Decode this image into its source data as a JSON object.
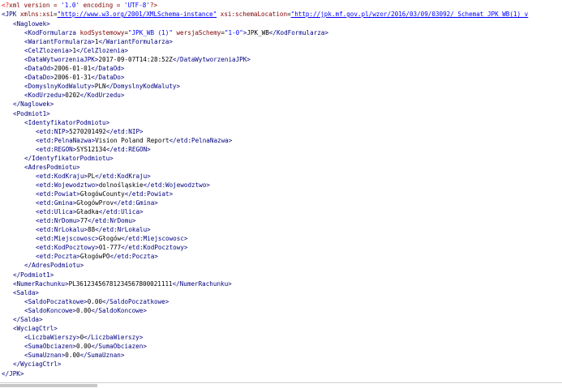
{
  "decl": {
    "a": "<?",
    "b": "xml version = ",
    "c": "'1.0'",
    "d": " encoding = ",
    "e": "'UTF-8'",
    "f": "?>"
  },
  "root": {
    "open_a": "<JPK ",
    "attr1": "xmlns:xsi",
    "eq1": "=",
    "v1": "\"http://www.w3.org/2001/XMLSchema-instance\"",
    "attr2": " xsi:schemaLocation",
    "eq2": "=",
    "v2": "\"http://jpk.mf.gov.pl/wzor/2016/03/09/03092/ Schemat_JPK_WB(1)_v",
    "close": "</JPK>"
  },
  "naglowek": {
    "open": "<Naglowek>",
    "kod": {
      "open": "<KodFormularza ",
      "a1": "kodSystemowy",
      "v1": "\"JPK_WB (1)\"",
      "a2": " wersjaSchemy",
      "v2": "\"1-0\"",
      "gt": ">",
      "text": "JPK_WB",
      "close": "</KodFormularza>"
    },
    "wariant": {
      "open": "<WariantFormularza>",
      "text": "1",
      "close": "</WariantFormularza>"
    },
    "cel": {
      "open": "<CelZlozenia>",
      "text": "1",
      "close": "</CelZlozenia>"
    },
    "data_wyt": {
      "open": "<DataWytworzeniaJPK>",
      "text": "2017-09-07T14:28:52Z",
      "close": "</DataWytworzeniaJPK>"
    },
    "data_od": {
      "open": "<DataOd>",
      "text": "2006-01-01",
      "close": "</DataOd>"
    },
    "data_do": {
      "open": "<DataDo>",
      "text": "2006-01-31",
      "close": "</DataDo>"
    },
    "waluta": {
      "open": "<DomyslnyKodWaluty>",
      "text": "PLN",
      "close": "</DomyslnyKodWaluty>"
    },
    "urzad": {
      "open": "<KodUrzedu>",
      "text": "0202",
      "close": "</KodUrzedu>"
    },
    "close": "</Naglowek>"
  },
  "podmiot": {
    "open": "<Podmiot1>",
    "ident": {
      "open": "<IdentyfikatorPodmiotu>",
      "nip": {
        "open": "<etd:NIP>",
        "text": "5270201492",
        "close": "</etd:NIP>"
      },
      "nazwa": {
        "open": "<etd:PelnaNazwa>",
        "text": "Vision Poland Report",
        "close": "</etd:PelnaNazwa>"
      },
      "regon": {
        "open": "<etd:REGON>",
        "text": "SYS12134",
        "close": "</etd:REGON>"
      },
      "close": "</IdentyfikatorPodmiotu>"
    },
    "adres": {
      "open": "<AdresPodmiotu>",
      "kraj": {
        "open": "<etd:KodKraju>",
        "text": "PL",
        "close": "</etd:KodKraju>"
      },
      "woj": {
        "open": "<etd:Wojewodztwo>",
        "text": "dolnośląskie",
        "close": "</etd:Wojewodztwo>"
      },
      "powiat": {
        "open": "<etd:Powiat>",
        "text": "GłogówCounty",
        "close": "</etd:Powiat>"
      },
      "gmina": {
        "open": "<etd:Gmina>",
        "text": "GłogówProv",
        "close": "</etd:Gmina>"
      },
      "ulica": {
        "open": "<etd:Ulica>",
        "text": "Gładka",
        "close": "</etd:Ulica>"
      },
      "domu": {
        "open": "<etd:NrDomu>",
        "text": "77",
        "close": "</etd:NrDomu>"
      },
      "lokalu": {
        "open": "<etd:NrLokalu>",
        "text": "88",
        "close": "</etd:NrLokalu>"
      },
      "miejsc": {
        "open": "<etd:Miejscowosc>",
        "text": "Głogów",
        "close": "</etd:Miejscowosc>"
      },
      "kodp": {
        "open": "<etd:KodPocztowy>",
        "text": "01-777",
        "close": "</etd:KodPocztowy>"
      },
      "poczta": {
        "open": "<etd:Poczta>",
        "text": "GłogówPO",
        "close": "</etd:Poczta>"
      },
      "close": "</AdresPodmiotu>"
    },
    "close": "</Podmiot1>"
  },
  "rachunek": {
    "open": "<NumerRachunku>",
    "text": "PL36123456781234567800021111",
    "close": "</NumerRachunku>"
  },
  "salda": {
    "open": "<Salda>",
    "pocz": {
      "open": "<SaldoPoczatkowe>",
      "text": "0.00",
      "close": "</SaldoPoczatkowe>"
    },
    "konc": {
      "open": "<SaldoKoncowe>",
      "text": "0.00",
      "close": "</SaldoKoncowe>"
    },
    "close": "</Salda>"
  },
  "ctrl": {
    "open": "<WyciagCtrl>",
    "liczba": {
      "open": "<LiczbaWierszy>",
      "text": "0",
      "close": "</LiczbaWierszy>"
    },
    "obc": {
      "open": "<SumaObciazen>",
      "text": "0.00",
      "close": "</SumaObciazen>"
    },
    "uzn": {
      "open": "<SumaUznan>",
      "text": "0.00",
      "close": "</SumaUznan>"
    },
    "close": "</WyciagCtrl>"
  }
}
